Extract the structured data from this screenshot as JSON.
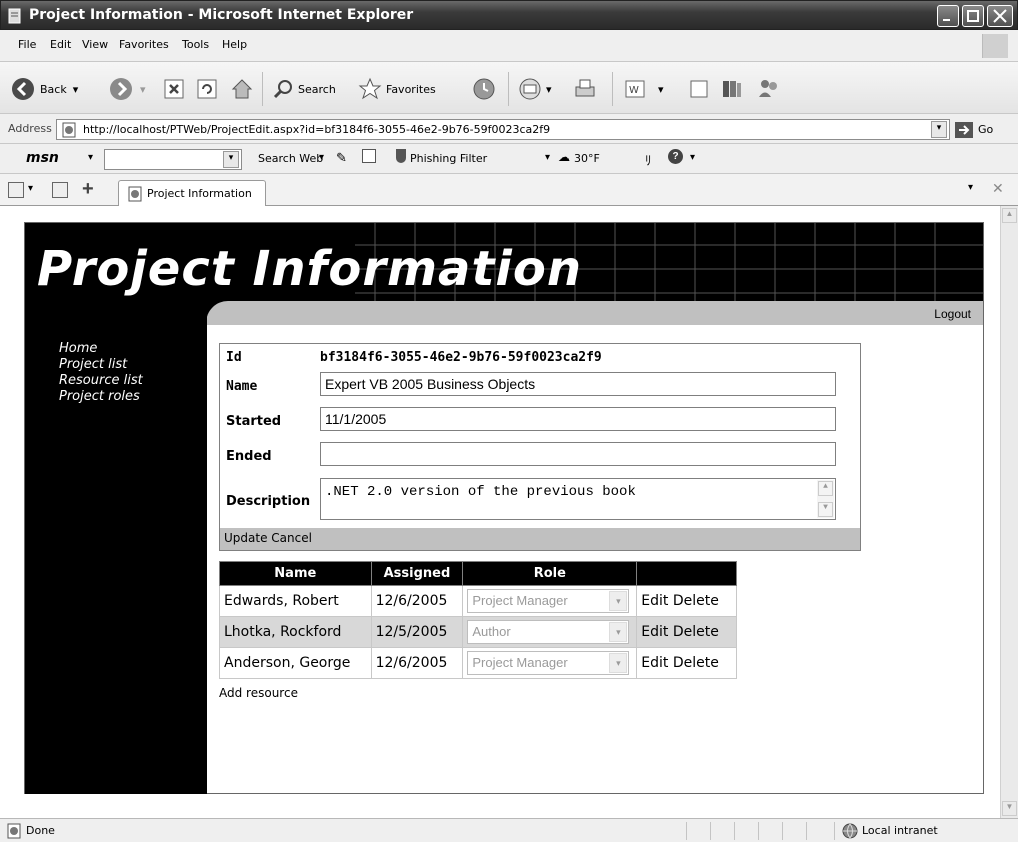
{
  "window": {
    "title": "Project Information - Microsoft Internet Explorer"
  },
  "menu": [
    "File",
    "Edit",
    "View",
    "Favorites",
    "Tools",
    "Help"
  ],
  "toolbar": {
    "back": "Back",
    "search": "Search",
    "favorites": "Favorites"
  },
  "address": {
    "label": "Address",
    "url": "http://localhost/PTWeb/ProjectEdit.aspx?id=bf3184f6-3055-46e2-9b76-59f0023ca2f9",
    "go": "Go"
  },
  "msn": {
    "logo": "msn",
    "search_web": "Search Web",
    "phishing": "Phishing Filter",
    "weather": "30°F"
  },
  "tab": {
    "label": "Project Information"
  },
  "page": {
    "title": "Project Information",
    "logout": "Logout",
    "nav": [
      "Home",
      "Project list",
      "Resource list",
      "Project roles"
    ],
    "fields": {
      "id_label": "Id",
      "id_value": "bf3184f6-3055-46e2-9b76-59f0023ca2f9",
      "name_label": "Name",
      "name_value": "Expert VB 2005 Business Objects",
      "started_label": "Started",
      "started_value": "11/1/2005",
      "ended_label": "Ended",
      "ended_value": "",
      "description_label": "Description",
      "description_value": ".NET 2.0 version of the previous book"
    },
    "actions": {
      "update": "Update",
      "cancel": "Cancel"
    },
    "resources": {
      "headers": [
        "Name",
        "Assigned",
        "Role",
        ""
      ],
      "rows": [
        {
          "name": "Edwards, Robert",
          "assigned": "12/6/2005",
          "role": "Project Manager",
          "edit": "Edit",
          "delete": "Delete"
        },
        {
          "name": "Lhotka, Rockford",
          "assigned": "12/5/2005",
          "role": "Author",
          "edit": "Edit",
          "delete": "Delete"
        },
        {
          "name": "Anderson, George",
          "assigned": "12/6/2005",
          "role": "Project Manager",
          "edit": "Edit",
          "delete": "Delete"
        }
      ],
      "add": "Add resource"
    }
  },
  "status": {
    "text": "Done",
    "zone": "Local intranet"
  }
}
